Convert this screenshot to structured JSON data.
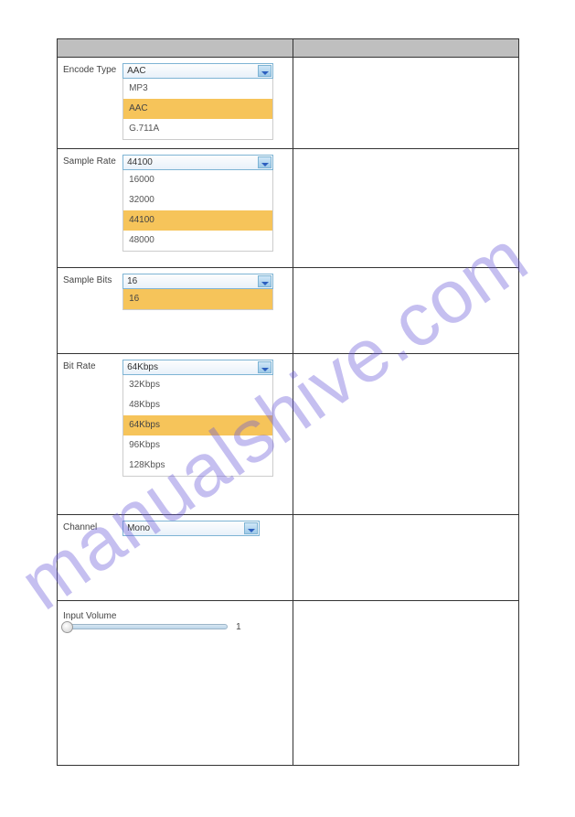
{
  "watermarkText": "manualshive.com",
  "rows": {
    "encodeType": {
      "label": "Encode Type",
      "selected": "AAC",
      "options": [
        "MP3",
        "AAC",
        "G.711A"
      ]
    },
    "sampleRate": {
      "label": "Sample Rate",
      "selected": "44100",
      "options": [
        "16000",
        "32000",
        "44100",
        "48000"
      ]
    },
    "sampleBits": {
      "label": "Sample Bits",
      "selected": "16",
      "options": [
        "16"
      ]
    },
    "bitRate": {
      "label": "Bit Rate",
      "selected": "64Kbps",
      "options": [
        "32Kbps",
        "48Kbps",
        "64Kbps",
        "96Kbps",
        "128Kbps"
      ]
    },
    "channel": {
      "label": "Channel",
      "selected": "Mono"
    },
    "inputVolume": {
      "label": "Input Volume",
      "value": "1"
    }
  }
}
